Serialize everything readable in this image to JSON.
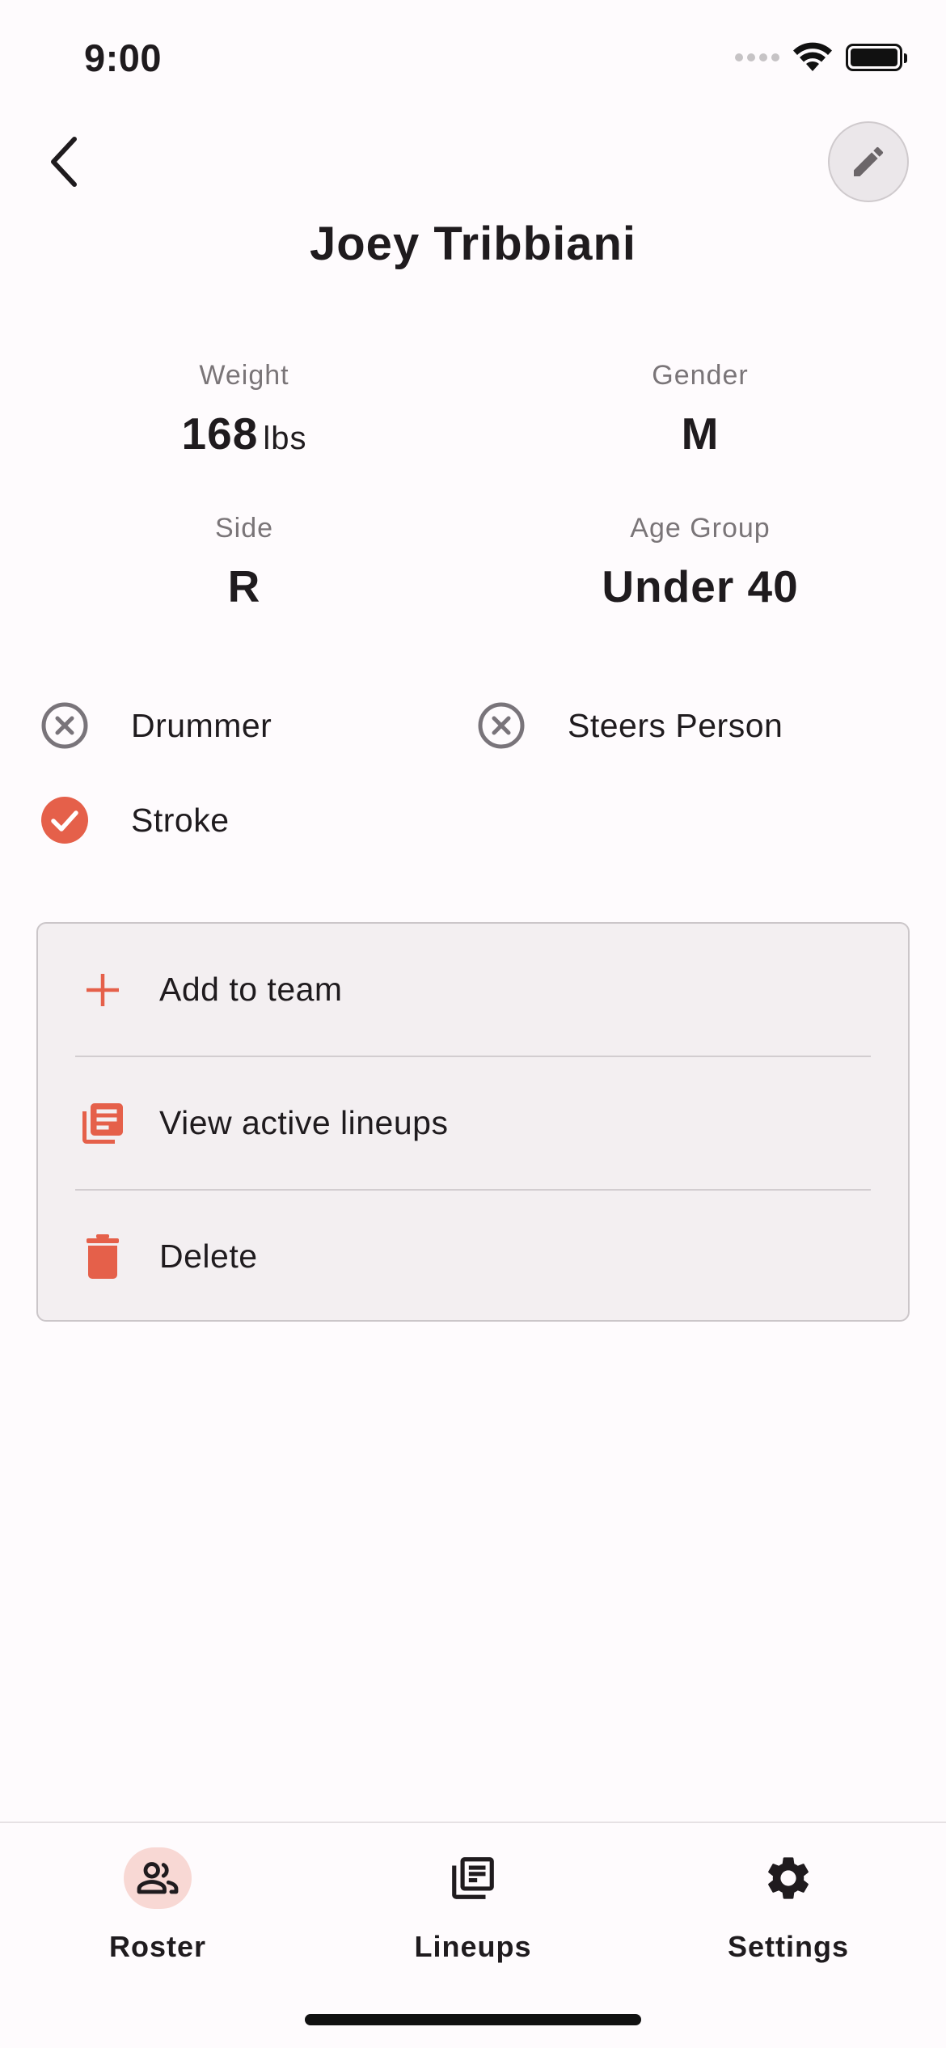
{
  "status_bar": {
    "time": "9:00"
  },
  "header": {
    "player_name": "Joey Tribbiani"
  },
  "stats": {
    "weight": {
      "label": "Weight",
      "value": "168",
      "unit": "lbs"
    },
    "gender": {
      "label": "Gender",
      "value": "M"
    },
    "side": {
      "label": "Side",
      "value": "R"
    },
    "age_group": {
      "label": "Age Group",
      "value": "Under 40"
    }
  },
  "roles": [
    {
      "label": "Drummer",
      "checked": false,
      "icon": "cancel-circle-icon"
    },
    {
      "label": "Steers Person",
      "checked": false,
      "icon": "cancel-circle-icon"
    },
    {
      "label": "Stroke",
      "checked": true,
      "icon": "check-circle-icon"
    }
  ],
  "actions": [
    {
      "label": "Add to team",
      "icon": "plus-icon"
    },
    {
      "label": "View active lineups",
      "icon": "library-books-icon"
    },
    {
      "label": "Delete",
      "icon": "trash-icon"
    }
  ],
  "bottom_nav": [
    {
      "label": "Roster",
      "icon": "people-icon",
      "active": true
    },
    {
      "label": "Lineups",
      "icon": "library-books-icon",
      "active": false
    },
    {
      "label": "Settings",
      "icon": "gear-icon",
      "active": false
    }
  ],
  "colors": {
    "accent": "#e5604a",
    "background": "#fefbfd",
    "card": "#f3eff1",
    "muted_text": "#7a7578",
    "nav_active_pill": "#f8d8d4"
  }
}
